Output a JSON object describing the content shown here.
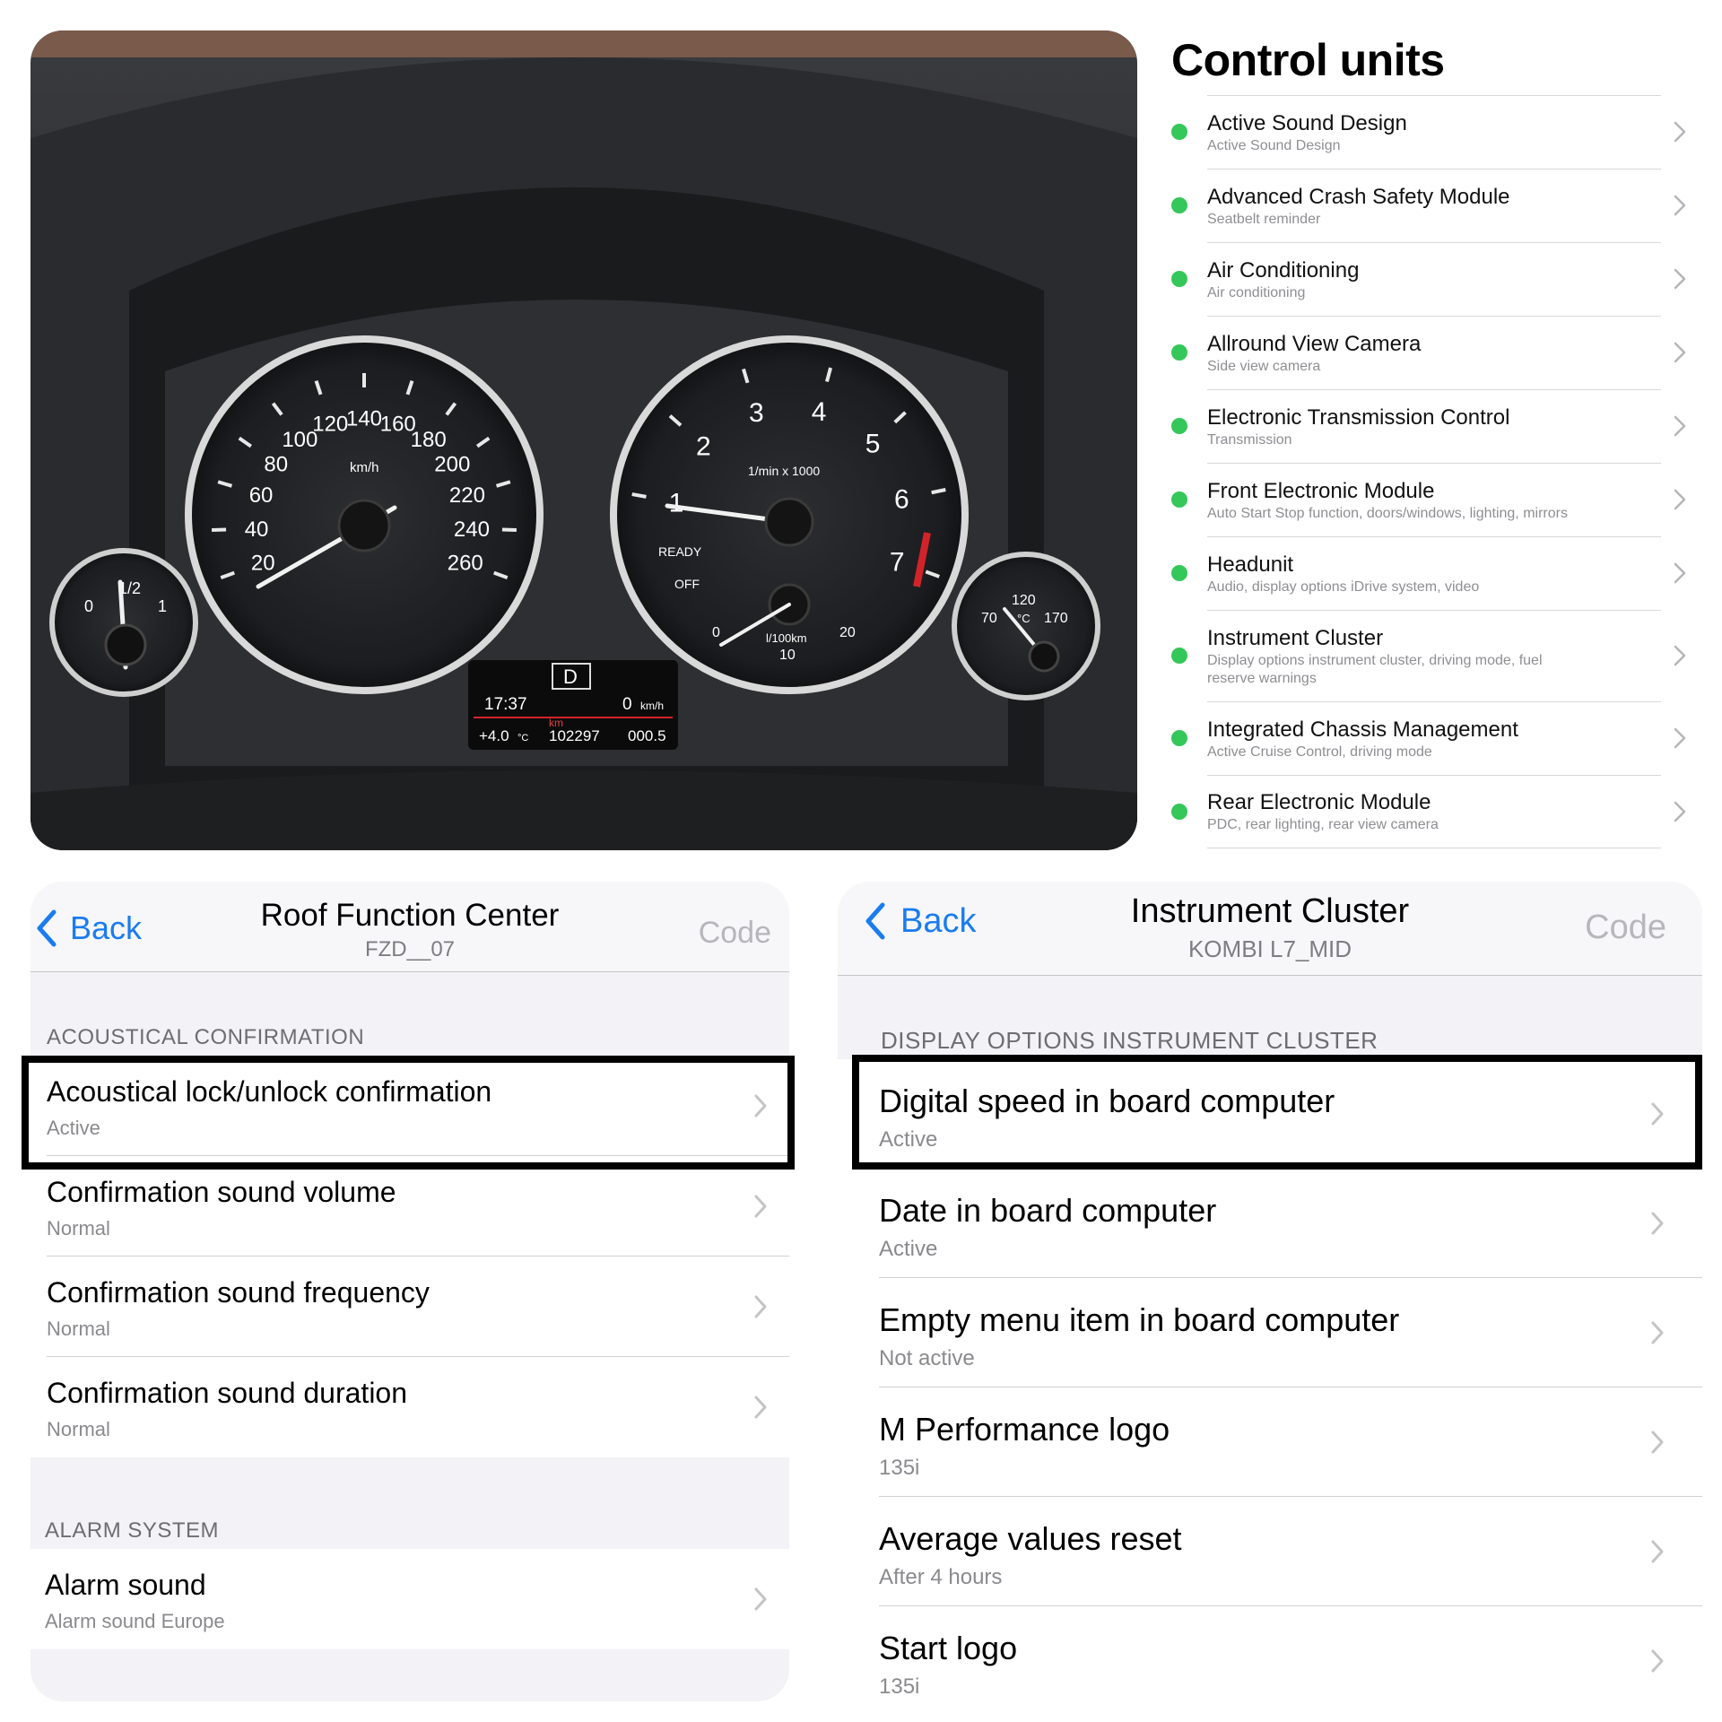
{
  "dashboard": {
    "speedometer": {
      "unit": "km/h",
      "labels": [
        "20",
        "40",
        "60",
        "80",
        "100",
        "120",
        "140",
        "160",
        "180",
        "200",
        "220",
        "240",
        "260"
      ]
    },
    "tachometer": {
      "unit": "1/min x 1000",
      "labels": [
        "1",
        "2",
        "3",
        "4",
        "5",
        "6",
        "7"
      ],
      "ready": "READY",
      "off": "OFF"
    },
    "consumption": {
      "unit": "l/100km",
      "labels": [
        "0",
        "10",
        "20"
      ]
    },
    "fuel_gauge": {
      "labels": [
        "0",
        "1/2",
        "1"
      ]
    },
    "temp_gauge": {
      "labels": [
        "70",
        "120",
        "170"
      ],
      "unit": "°C"
    },
    "display": {
      "gear": "D",
      "time": "17:37",
      "speed": "0",
      "speed_unit": "km/h",
      "outside_temp": "+4.0",
      "temp_unit": "°C",
      "odo_unit": "km",
      "odometer": "102297",
      "trip": "000.5"
    }
  },
  "control_units": {
    "title": "Control units",
    "items": [
      {
        "name": "Active Sound Design",
        "sub": "Active Sound Design"
      },
      {
        "name": "Advanced Crash Safety Module",
        "sub": "Seatbelt reminder"
      },
      {
        "name": "Air Conditioning",
        "sub": "Air conditioning"
      },
      {
        "name": "Allround View Camera",
        "sub": "Side view camera"
      },
      {
        "name": "Electronic Transmission Control",
        "sub": "Transmission"
      },
      {
        "name": "Front Electronic Module",
        "sub": "Auto Start Stop function, doors/windows, lighting, mirrors"
      },
      {
        "name": "Headunit",
        "sub": "Audio, display options iDrive system, video"
      },
      {
        "name": "Instrument Cluster",
        "sub": "Display options instrument cluster, driving mode, fuel",
        "sub2": "reserve warnings"
      },
      {
        "name": "Integrated Chassis Management",
        "sub": "Active Cruise Control, driving mode"
      },
      {
        "name": "Rear Electronic Module",
        "sub": "PDC, rear lighting, rear view camera"
      }
    ],
    "status_color": "#34c759"
  },
  "roof_panel": {
    "back": "Back",
    "title": "Roof Function Center",
    "subtitle": "FZD__07",
    "code": "Code",
    "section1": "ACOUSTICAL CONFIRMATION",
    "rows1": [
      {
        "title": "Acoustical lock/unlock confirmation",
        "value": "Active"
      },
      {
        "title": "Confirmation sound volume",
        "value": "Normal"
      },
      {
        "title": "Confirmation sound frequency",
        "value": "Normal"
      },
      {
        "title": "Confirmation sound duration",
        "value": "Normal"
      }
    ],
    "section2": "ALARM SYSTEM",
    "rows2": [
      {
        "title": "Alarm sound",
        "value": "Alarm sound Europe"
      }
    ]
  },
  "cluster_panel": {
    "back": "Back",
    "title": "Instrument Cluster",
    "subtitle": "KOMBI L7_MID",
    "code": "Code",
    "section1": "DISPLAY OPTIONS INSTRUMENT CLUSTER",
    "rows1": [
      {
        "title": "Digital speed in board computer",
        "value": "Active"
      },
      {
        "title": "Date in board computer",
        "value": "Active"
      },
      {
        "title": "Empty menu item in board computer",
        "value": "Not active"
      },
      {
        "title": "M Performance logo",
        "value": "135i"
      },
      {
        "title": "Average values reset",
        "value": "After 4 hours"
      },
      {
        "title": "Start logo",
        "value": "135i"
      }
    ]
  },
  "colors": {
    "ios_blue": "#1a7cf0",
    "chevron": "#c4c4c7",
    "highlight_border": "#000000",
    "redline": "#d3232a"
  }
}
